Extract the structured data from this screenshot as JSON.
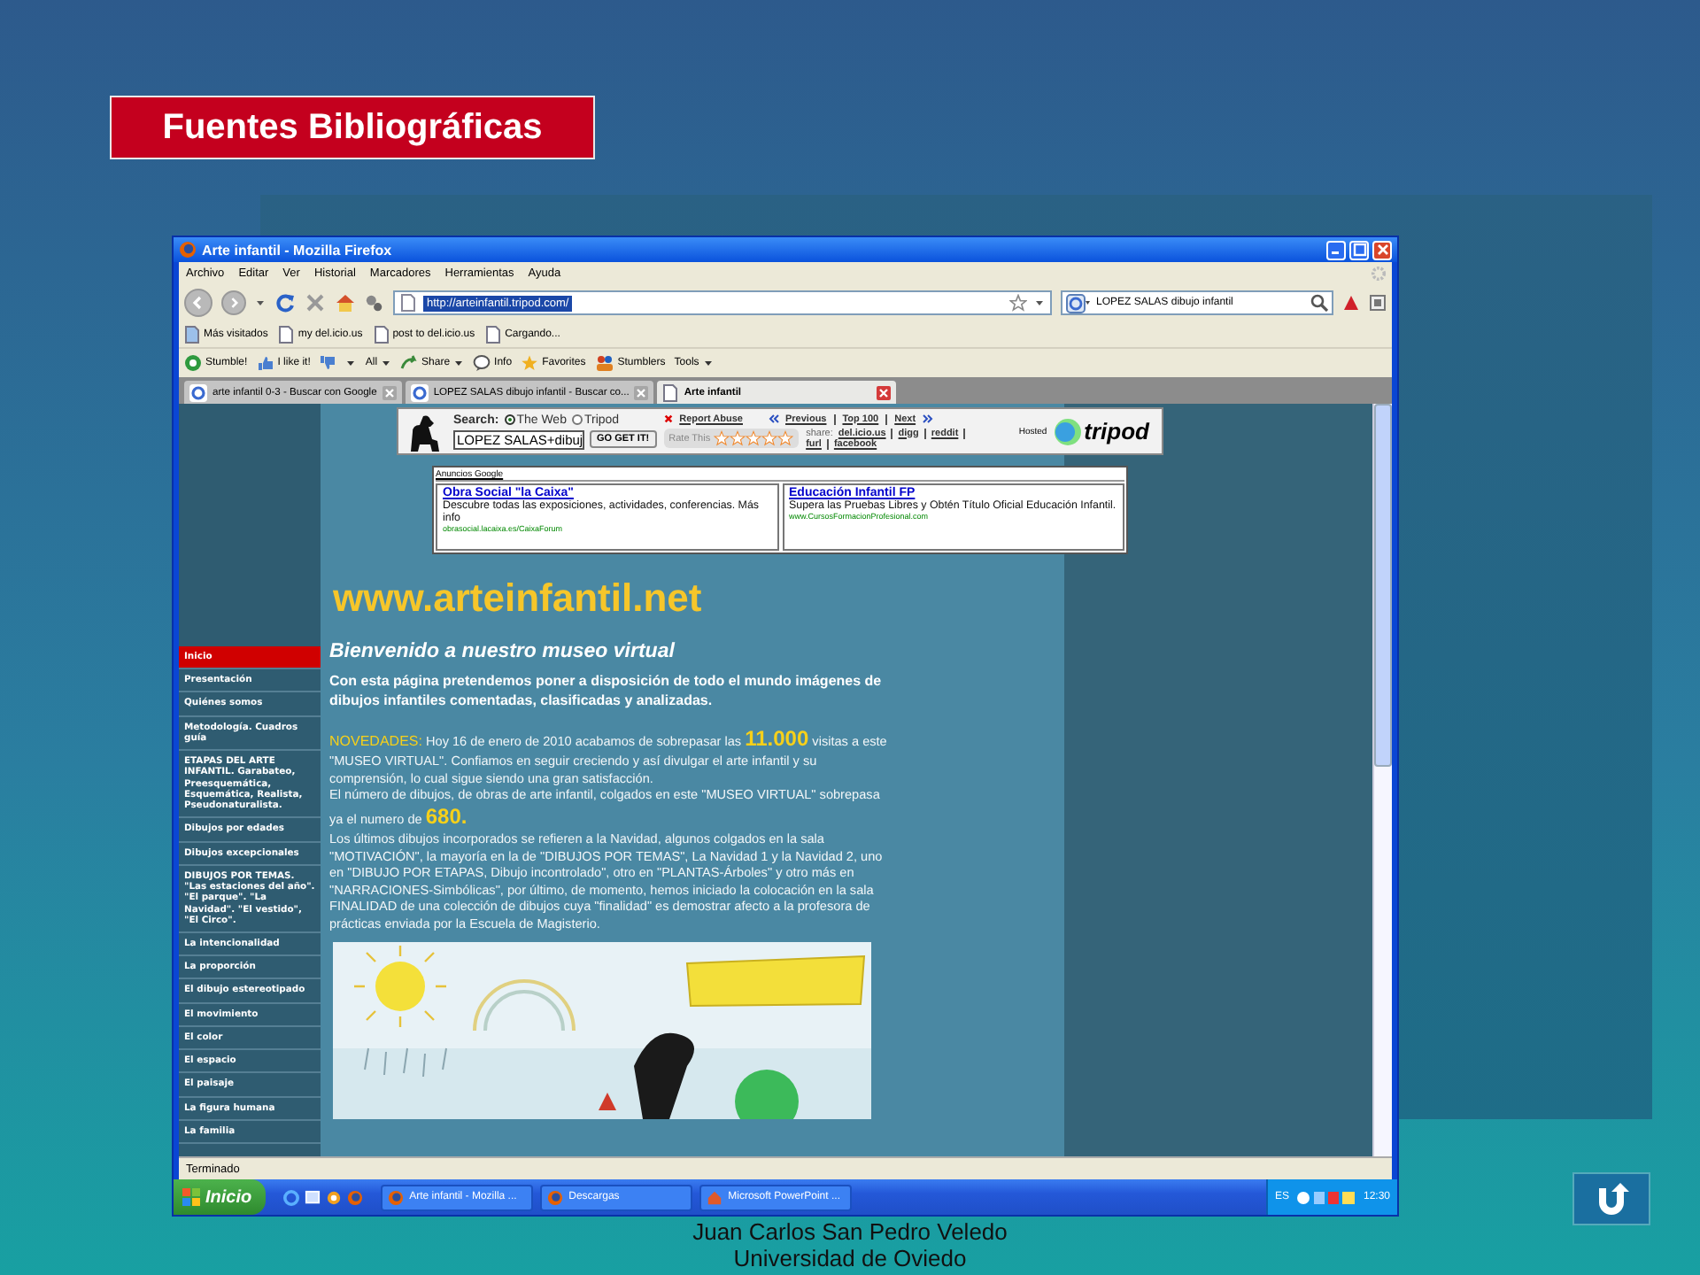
{
  "slide": {
    "title": "Fuentes Bibliográficas",
    "footer": [
      "Juan Carlos San Pedro Veledo",
      "Universidad de Oviedo"
    ]
  },
  "browser": {
    "title": "Arte infantil - Mozilla Firefox",
    "menu": [
      "Archivo",
      "Editar",
      "Ver",
      "Historial",
      "Marcadores",
      "Herramientas",
      "Ayuda"
    ],
    "url": "http://arteinfantil.tripod.com/",
    "search": "LOPEZ SALAS dibujo infantil",
    "bookmarks": [
      "Más visitados",
      "my del.icio.us",
      "post to del.icio.us",
      "Cargando..."
    ],
    "toolbar": [
      "Stumble!",
      "I like it!",
      "All",
      "Share",
      "Info",
      "Favorites",
      "Stumblers",
      "Tools"
    ],
    "tabs": [
      {
        "label": "arte infantil 0-3 - Buscar con Google",
        "selected": false
      },
      {
        "label": "LOPEZ SALAS dibujo infantil - Buscar co...",
        "selected": false
      },
      {
        "label": "Arte infantil",
        "selected": true
      }
    ],
    "status": "Terminado"
  },
  "page": {
    "tripod": {
      "search_label": "Search:",
      "options": [
        {
          "label": "The Web",
          "selected": true
        },
        {
          "label": "Tripod",
          "selected": false
        }
      ],
      "query": "LOPEZ SALAS+dibuj",
      "go": "GO GET IT!",
      "report": "Report Abuse",
      "nav": [
        "Previous",
        "Top 100",
        "Next"
      ],
      "rate": "Rate This",
      "stars": 0,
      "share_label": "share:",
      "share": [
        "del.icio.us",
        "digg",
        "reddit",
        "furl",
        "facebook"
      ],
      "hosted": "Hosted",
      "logo": "tripod"
    },
    "ads": {
      "header": "Anuncios Google",
      "items": [
        {
          "title": "Obra Social \"la Caixa\"",
          "text": "Descubre todas las exposiciones, actividades, conferencias. Más info",
          "url": "obrasocial.lacaixa.es/CaixaForum"
        },
        {
          "title": "Educación Infantil FP",
          "text": "Supera las Pruebas Libres y Obtén Título Oficial Educación Infantil.",
          "url": "www.CursosFormacionProfesional.com"
        }
      ]
    },
    "site_title": "www.arteinfantil.net",
    "sidebar": [
      {
        "label": "Inicio",
        "selected": true
      },
      {
        "label": "Presentación",
        "selected": false
      },
      {
        "label": "Quiénes somos",
        "selected": false
      },
      {
        "label": "Metodología. Cuadros guía",
        "selected": false
      },
      {
        "label": "ETAPAS DEL ARTE INFANTIL. Garabateo, Preesquemática, Esquemática, Realista, Pseudonaturalista.",
        "selected": false
      },
      {
        "label": "Dibujos por edades",
        "selected": false
      },
      {
        "label": "Dibujos excepcionales",
        "selected": false
      },
      {
        "label": "DIBUJOS POR TEMAS. \"Las estaciones del año\". \"El parque\". \"La Navidad\". \"El vestido\", \"El Circo\".",
        "selected": false
      },
      {
        "label": "La intencionalidad",
        "selected": false
      },
      {
        "label": "La proporción",
        "selected": false
      },
      {
        "label": "El dibujo estereotipado",
        "selected": false
      },
      {
        "label": "El movimiento",
        "selected": false
      },
      {
        "label": "El color",
        "selected": false
      },
      {
        "label": "El espacio",
        "selected": false
      },
      {
        "label": "El paisaje",
        "selected": false
      },
      {
        "label": "La figura humana",
        "selected": false
      },
      {
        "label": "La familia",
        "selected": false
      }
    ],
    "welcome": "Bienvenido a nuestro museo virtual",
    "intro": "Con esta página pretendemos poner a disposición de todo el mundo imágenes de dibujos infantiles comentadas, clasificadas y analizadas.",
    "news": [
      [
        {
          "kind": "label",
          "text": "NOVEDADES:"
        },
        {
          "kind": "plain",
          "text": " Hoy 16 de enero de 2010 acabamos de sobrepasar las "
        },
        {
          "kind": "number",
          "text": "11.000"
        },
        {
          "kind": "plain",
          "text": " visitas  a este \"MUSEO VIRTUAL\". Confiamos en seguir creciendo y así divulgar el arte infantil y su comprensión, lo cual sigue siendo una gran satisfacción."
        }
      ],
      [
        {
          "kind": "plain",
          "text": "El número de dibujos, de obras de arte infantil, colgados en este \"MUSEO VIRTUAL\" sobrepasa ya el numero de "
        },
        {
          "kind": "number",
          "text": "680."
        }
      ],
      [
        {
          "kind": "plain",
          "text": "Los últimos dibujos incorporados se refieren a la Navidad, algunos colgados en la sala \"MOTIVACIÓN\", la mayoría en la de \"DIBUJOS POR TEMAS\", La Navidad 1 y la Navidad 2, uno en \"DIBUJO POR ETAPAS,  Dibujo incontrolado\", otro en  \"PLANTAS-Árboles\" y  otro más en \"NARRACIONES-Simbólicas\", por último, de momento, hemos iniciado la colocación en la sala FINALIDAD de una colección de dibujos cuya \"finalidad\" es demostrar afecto a la profesora de prácticas enviada por la Escuela de Magisterio."
        }
      ]
    ]
  },
  "taskbar": {
    "start": "Inicio",
    "tasks": [
      "Arte infantil - Mozilla ...",
      "Descargas",
      "Microsoft PowerPoint ..."
    ],
    "language": "ES",
    "clock": "12:30"
  }
}
